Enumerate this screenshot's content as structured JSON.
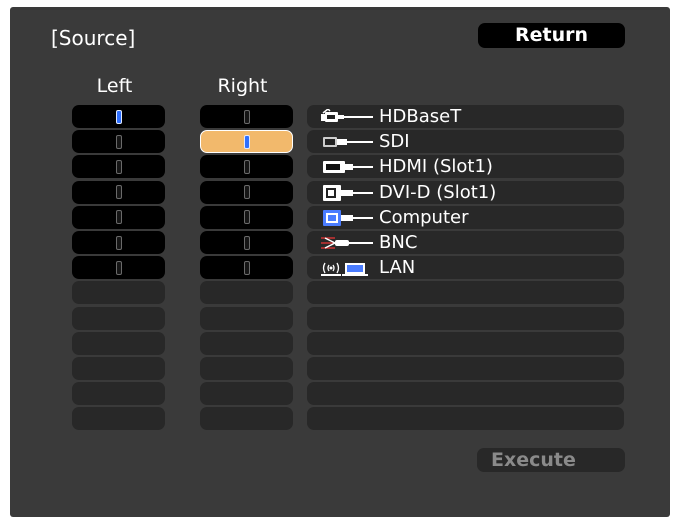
{
  "header": {
    "title": "[Source]",
    "return_label": "Return"
  },
  "columns": {
    "left_label": "Left",
    "right_label": "Right"
  },
  "left_column": {
    "active_rows": 7,
    "total_rows": 13,
    "selected_row": 0,
    "on_row": 0
  },
  "right_column": {
    "active_rows": 7,
    "total_rows": 13,
    "selected_row": 1,
    "on_row": 1
  },
  "sources": [
    {
      "label": "HDBaseT",
      "icon": "hdbaset-cable-icon"
    },
    {
      "label": "SDI",
      "icon": "sdi-cable-icon"
    },
    {
      "label": "HDMI (Slot1)",
      "icon": "hdmi-cable-icon"
    },
    {
      "label": "DVI-D (Slot1)",
      "icon": "dvi-cable-icon"
    },
    {
      "label": "Computer",
      "icon": "vga-cable-icon"
    },
    {
      "label": "BNC",
      "icon": "bnc-cable-icon"
    },
    {
      "label": "LAN",
      "icon": "wireless-lan-icon"
    }
  ],
  "source_rows_total": 13,
  "footer": {
    "execute_label": "Execute"
  },
  "colors": {
    "panel": "#3a3a3a",
    "selected": "#f2b96c",
    "toggle_on": "#2e6fff"
  }
}
